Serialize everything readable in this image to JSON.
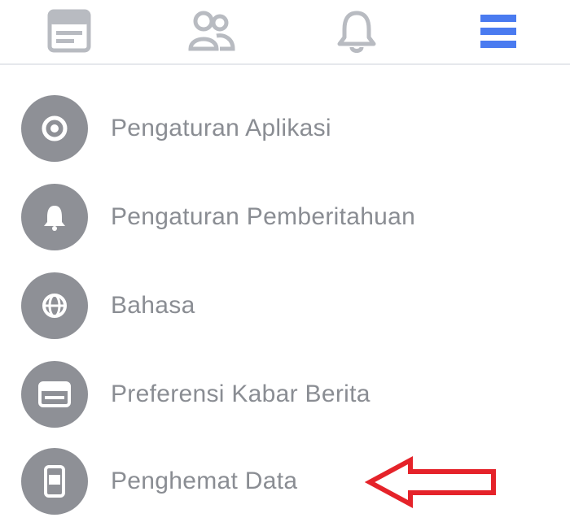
{
  "nav": {
    "tabs": [
      {
        "icon": "news-feed-icon"
      },
      {
        "icon": "friends-icon"
      },
      {
        "icon": "notifications-bell-icon"
      },
      {
        "icon": "menu-hamburger-icon",
        "active": true
      }
    ],
    "active_color": "#4a7bf0",
    "inactive_color": "#b8bbc1"
  },
  "menu": {
    "items": [
      {
        "label": "Pengaturan Aplikasi",
        "icon": "gear-icon"
      },
      {
        "label": "Pengaturan Pemberitahuan",
        "icon": "bell-icon"
      },
      {
        "label": "Bahasa",
        "icon": "globe-icon"
      },
      {
        "label": "Preferensi Kabar Berita",
        "icon": "feed-icon"
      },
      {
        "label": "Penghemat Data",
        "icon": "phone-icon"
      }
    ]
  },
  "annotation": {
    "icon": "red-arrow-icon",
    "color": "#e5232a"
  }
}
